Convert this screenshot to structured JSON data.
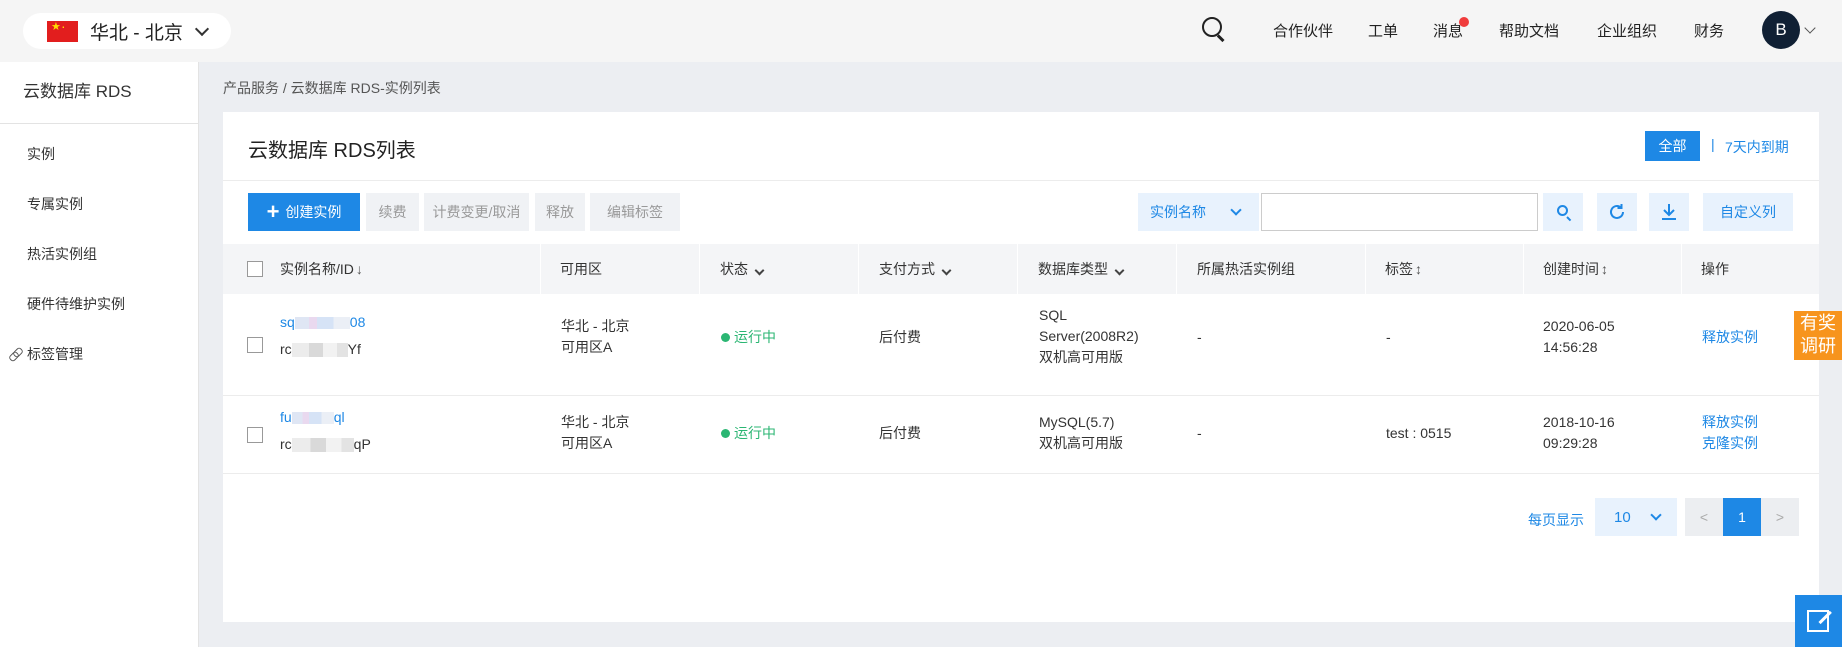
{
  "topbar": {
    "region": "华北 - 北京",
    "nav": [
      "合作伙伴",
      "工单",
      "消息",
      "帮助文档",
      "企业组织",
      "财务"
    ],
    "avatar_letter": "B"
  },
  "sidebar": {
    "title": "云数据库 RDS",
    "items": [
      "实例",
      "专属实例",
      "热活实例组",
      "硬件待维护实例",
      "标签管理"
    ]
  },
  "breadcrumb": "产品服务 / 云数据库 RDS-实例列表",
  "panel": {
    "title": "云数据库 RDS列表",
    "filter_all": "全部",
    "filter_separator": "|",
    "filter_7days": "7天内到期"
  },
  "toolbar": {
    "create": "创建实例",
    "renew": "续费",
    "billing_change": "计费变更/取消",
    "release": "释放",
    "edit_tags": "编辑标签",
    "search_field": "实例名称",
    "search_placeholder": "",
    "custom_columns": "自定义列"
  },
  "table": {
    "headers": [
      "实例名称/ID",
      "可用区",
      "状态",
      "支付方式",
      "数据库类型",
      "所属热活实例组",
      "标签",
      "创建时间",
      "操作"
    ],
    "rows": [
      {
        "name_prefix": "sq",
        "name_suffix": "08",
        "id_prefix": "rc",
        "id_suffix": "Yf",
        "zone_1": "华北 - 北京",
        "zone_2": "可用区A",
        "status": "运行中",
        "payment": "后付费",
        "db_1": "SQL",
        "db_2": "Server(2008R2)",
        "db_3": "双机高可用版",
        "group": "-",
        "tag": "-",
        "created_date": "2020-06-05",
        "created_time": "14:56:28",
        "action_1": "释放实例"
      },
      {
        "name_prefix": "fu",
        "name_suffix": "ql",
        "id_prefix": "rc",
        "id_suffix": "qP",
        "zone_1": "华北 - 北京",
        "zone_2": "可用区A",
        "status": "运行中",
        "payment": "后付费",
        "db_1": "MySQL(5.7)",
        "db_2": "双机高可用版",
        "group": "-",
        "tag": "test : 0515",
        "created_date": "2018-10-16",
        "created_time": "09:29:28",
        "action_1": "释放实例",
        "action_2": "克隆实例"
      }
    ]
  },
  "pagination": {
    "label": "每页显示",
    "page_size": "10",
    "prev": "<",
    "current": "1",
    "next": ">"
  },
  "float": {
    "survey_1": "有奖",
    "survey_2": "调研"
  },
  "colors": {
    "primary": "#1e88e5",
    "running": "#2bb673",
    "survey": "#f7941d",
    "badge": "#f03c3c"
  },
  "icons": [
    "china-flag-icon",
    "chevron-down-icon",
    "search-icon",
    "plus-icon",
    "refresh-icon",
    "download-icon",
    "sort-icon",
    "link-icon",
    "edit-icon"
  ]
}
